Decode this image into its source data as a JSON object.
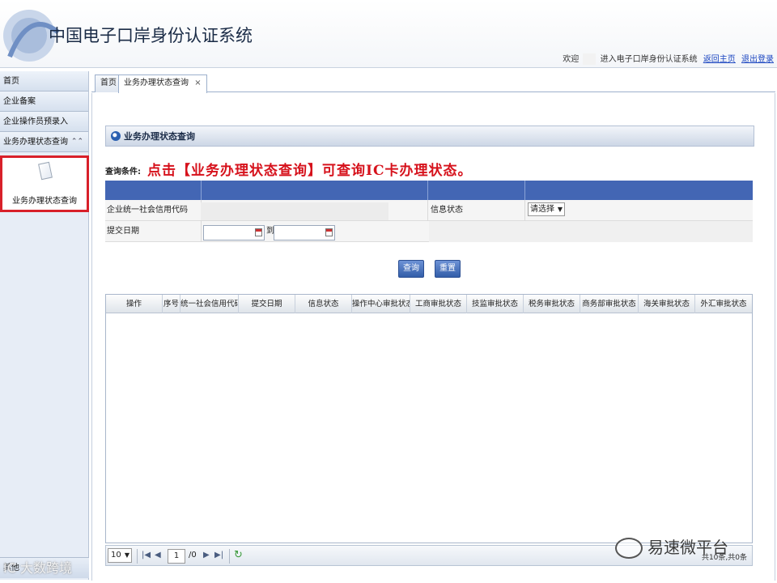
{
  "header": {
    "app_title": "中国电子口岸身份认证系统",
    "welcome": "欢迎",
    "enter_text": "进入电子口岸身份认证系统",
    "home_link": "返回主页",
    "logout_link": "退出登录"
  },
  "sidebar": {
    "items": [
      {
        "label": "首页"
      },
      {
        "label": "企业备案"
      },
      {
        "label": "企业操作员预录入"
      },
      {
        "label": "业务办理状态查询"
      }
    ],
    "expand_icon": "double-chevron-up-icon",
    "sub_item_label": "业务办理状态查询",
    "bottom_label": "其他"
  },
  "tabs": [
    {
      "label": "首页"
    },
    {
      "label": "业务办理状态查询",
      "close": "×"
    }
  ],
  "section": {
    "title": "业务办理状态查询"
  },
  "query": {
    "label": "查询条件:",
    "annotation": "点击【业务办理状态查询】可查询IC卡办理状态。",
    "credit_code_label": "企业统一社会信用代码",
    "info_status_label": "信息状态",
    "info_status_value": "请选择",
    "submit_date_label": "提交日期",
    "to_label": "到",
    "search_button": "查询",
    "reset_button": "重置"
  },
  "grid": {
    "columns": [
      "操作",
      "序号",
      "统一社会信用代码",
      "提交日期",
      "信息状态",
      "操作中心审批状态",
      "工商审批状态",
      "技监审批状态",
      "税务审批状态",
      "商务部审批状态",
      "海关审批状态",
      "外汇审批状态"
    ]
  },
  "pager": {
    "page_size": "10",
    "current_page": "1",
    "total_pages": "/0",
    "info": "共10条,共0条"
  },
  "watermarks": {
    "right": "易速微平台",
    "left": "IC  大数跨境"
  },
  "colors": {
    "accent_blue": "#4366b4",
    "annotation_red": "#d6121c",
    "highlight_border": "#d8202a"
  }
}
